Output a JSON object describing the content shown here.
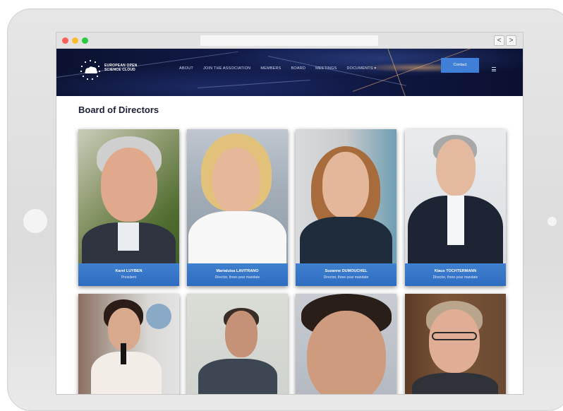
{
  "browser": {
    "nav_back_icon": "chevron-left-icon",
    "nav_forward_icon": "chevron-right-icon",
    "back_glyph": "<",
    "forward_glyph": ">"
  },
  "site": {
    "logo_line1": "EUROPEAN OPEN",
    "logo_line2": "SCIENCE CLOUD",
    "menu": [
      "ABOUT",
      "JOIN THE ASSOCIATION",
      "MEMBERS",
      "BOARD",
      "MEETINGS",
      "DOCUMENTS ▾"
    ],
    "contact_label": "Contact",
    "menu_icon": "hamburger-icon"
  },
  "page": {
    "title": "Board of Directors"
  },
  "directors": [
    {
      "name": "Karel LUYBEN",
      "role": "President"
    },
    {
      "name": "Marialuisa LAVITRANO",
      "role": "Director, three-year mandate"
    },
    {
      "name": "Suzanne DUMOUCHEL",
      "role": "Director, three-year mandate"
    },
    {
      "name": "Klaus TOCHTERMANN",
      "role": "Director, three-year mandate"
    }
  ],
  "colors": {
    "caption": "#3a78cc",
    "contact": "#3f7fd8",
    "title": "#1b1f3a"
  }
}
